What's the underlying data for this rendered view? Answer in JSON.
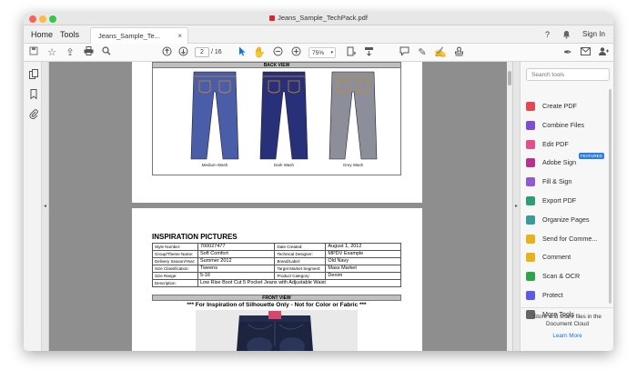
{
  "window": {
    "title": "Jeans_Sample_TechPack.pdf",
    "traffic_colors": [
      "#fc605c",
      "#fdbc40",
      "#34c84a"
    ]
  },
  "tabs": {
    "home": "Home",
    "tools": "Tools",
    "document": "Jeans_Sample_Te...",
    "close": "×",
    "sign_in": "Sign In"
  },
  "toolbar": {
    "page_current": "2",
    "page_separator": "/",
    "page_total": "16",
    "zoom": "75%"
  },
  "collapse": {
    "left": "◂",
    "right": "▸"
  },
  "document": {
    "back_view_header": "BACK VIEW",
    "jeans": [
      {
        "label": "Medium Wash",
        "color": "#4a5da8"
      },
      {
        "label": "Dark Wash",
        "color": "#29307a"
      },
      {
        "label": "Grey Wash",
        "color": "#8c8f99"
      }
    ],
    "inspiration_title": "INSPIRATION PICTURES",
    "spec": {
      "style_number_label": "Style Number:",
      "style_number": "700027477",
      "date_created_label": "Date Created:",
      "date_created": "August 1, 2012",
      "group_label": "Group/Theme Name:",
      "group": "Soft Comfort",
      "designer_label": "Technical Designer:",
      "designer": "MPDV Example",
      "season_label": "Delivery Season/Year:",
      "season": "Summer 2012",
      "brand_label": "Brand/Label:",
      "brand": "Old Navy",
      "size_class_label": "Size Classification:",
      "size_class": "Tweens",
      "target_label": "Target Market Segment:",
      "target": "Mass Market",
      "size_range_label": "Size Range:",
      "size_range": "5-16",
      "category_label": "Product Category:",
      "category": "Denim",
      "description_label": "Description:",
      "description": "Low Rise Boot Cut 5 Pocket Jeans with Adjustable Waist"
    },
    "front_view_header": "FRONT VIEW",
    "front_caption": "*** For Inspiration of Silhouette Only - Not for Color or Fabric ***"
  },
  "right_pane": {
    "search_placeholder": "Search tools",
    "tools": [
      {
        "label": "Create PDF",
        "color": "#e34850",
        "icon": "create-pdf-icon"
      },
      {
        "label": "Combine Files",
        "color": "#7e4dd2",
        "icon": "combine-files-icon"
      },
      {
        "label": "Edit PDF",
        "color": "#e34f8a",
        "icon": "edit-pdf-icon"
      },
      {
        "label": "Adobe Sign",
        "color": "#b4338e",
        "icon": "adobe-sign-icon"
      },
      {
        "label": "Fill & Sign",
        "color": "#8f5ad6",
        "icon": "fill-sign-icon"
      },
      {
        "label": "Export PDF",
        "color": "#2d9d78",
        "icon": "export-pdf-icon"
      },
      {
        "label": "Organize Pages",
        "color": "#3b9b9b",
        "icon": "organize-pages-icon"
      },
      {
        "label": "Send for Comme...",
        "color": "#e8b21e",
        "icon": "send-for-comment-icon"
      },
      {
        "label": "Comment",
        "color": "#e8b21e",
        "icon": "comment-icon"
      },
      {
        "label": "Scan & OCR",
        "color": "#2ea44f",
        "icon": "scan-ocr-icon"
      },
      {
        "label": "Protect",
        "color": "#5c5ce0",
        "icon": "protect-icon"
      },
      {
        "label": "More Tools",
        "color": "#666666",
        "icon": "more-tools-icon"
      }
    ],
    "featured_badge": "FEATURED",
    "promo_line1": "Store and share files in the",
    "promo_line2": "Document Cloud",
    "learn_more": "Learn More"
  }
}
